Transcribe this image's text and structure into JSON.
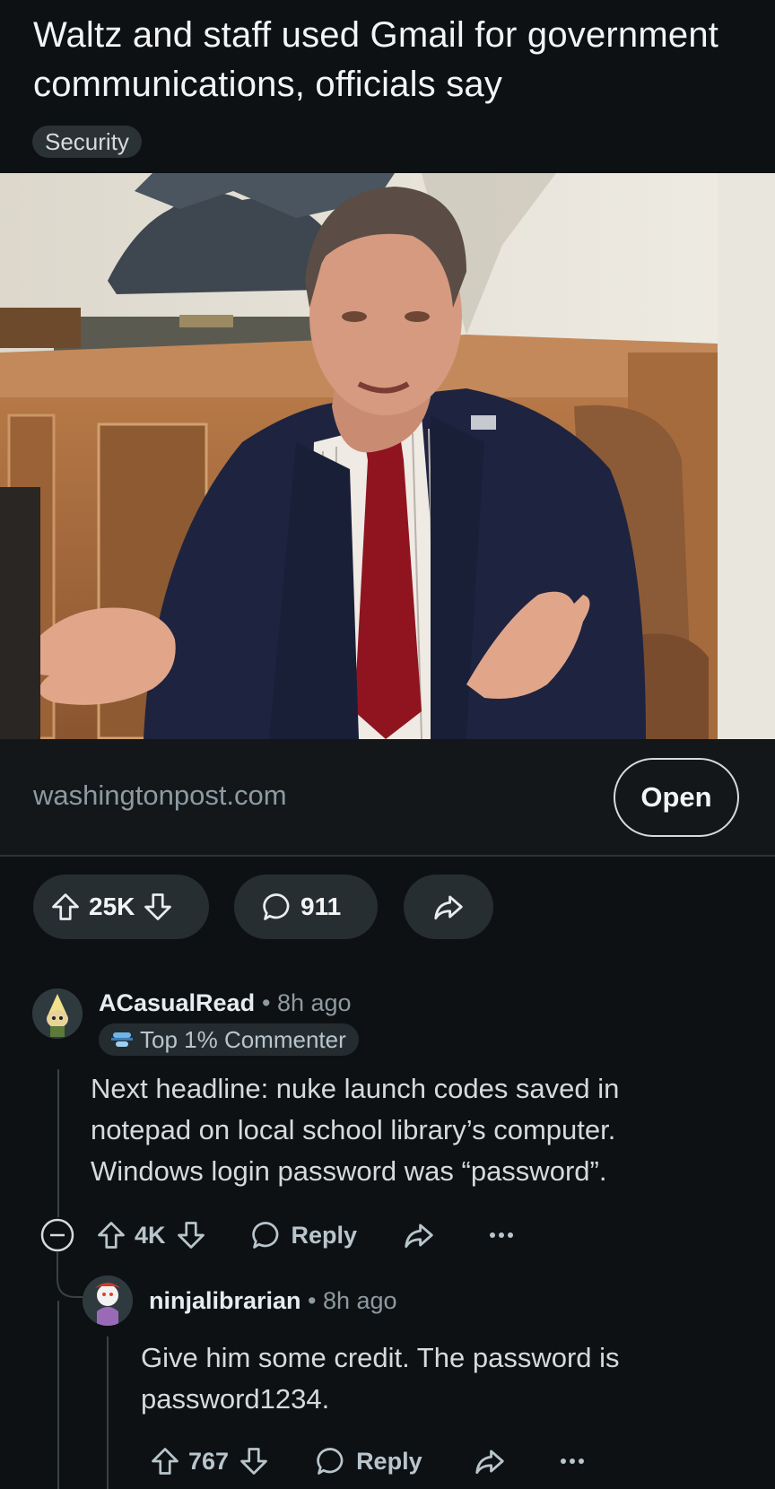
{
  "post": {
    "title": "Waltz and staff used Gmail for government communications, officials say",
    "flair": "Security",
    "domain": "washingtonpost.com",
    "open_label": "Open",
    "votes": "25K",
    "comments": "911"
  },
  "comments": [
    {
      "username": "ACasualRead",
      "time": "8h ago",
      "badge": "Top 1% Commenter",
      "body": "Next headline: nuke launch codes saved in notepad on local school library’s computer. Windows login password was “password”.",
      "votes": "4K",
      "reply_label": "Reply"
    },
    {
      "username": "ninjalibrarian",
      "time": "8h ago",
      "body": "Give him some credit. The password is password1234.",
      "votes": "767",
      "reply_label": "Reply"
    }
  ],
  "colors": {
    "background": "#0e1113",
    "pill": "#272e32",
    "text_muted": "#8d9aa1"
  }
}
